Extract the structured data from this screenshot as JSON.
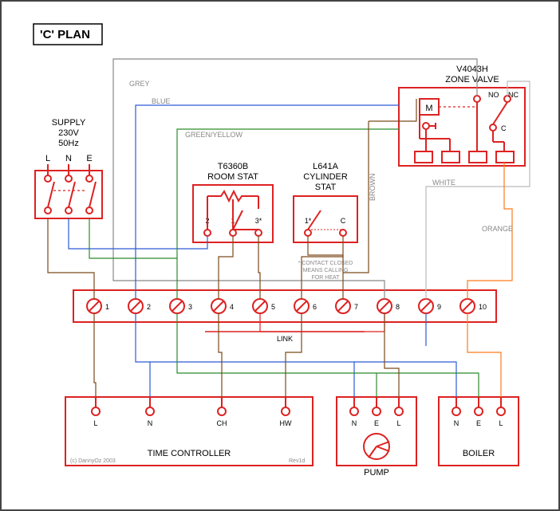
{
  "title": "'C' PLAN",
  "supply": {
    "label": "SUPPLY",
    "voltage": "230V",
    "freq": "50Hz",
    "L": "L",
    "N": "N",
    "E": "E"
  },
  "roomstat": {
    "model": "T6360B",
    "label": "ROOM STAT",
    "t1": "1",
    "t2": "2",
    "t3": "3*"
  },
  "cylstat": {
    "model": "L641A",
    "label1": "CYLINDER",
    "label2": "STAT",
    "t1": "1*",
    "t2": "C",
    "note1": "* CONTACT CLOSED",
    "note2": "MEANS CALLING",
    "note3": "FOR HEAT"
  },
  "zonevalve": {
    "model": "V4043H",
    "label": "ZONE VALVE",
    "M": "M",
    "NO": "NO",
    "NC": "NC",
    "C": "C"
  },
  "junction": {
    "link": "LINK",
    "t": [
      "1",
      "2",
      "3",
      "4",
      "5",
      "6",
      "7",
      "8",
      "9",
      "10"
    ]
  },
  "timecontroller": {
    "label": "TIME CONTROLLER",
    "L": "L",
    "N": "N",
    "CH": "CH",
    "HW": "HW",
    "rev": "Rev1d",
    "copy": "(c) DannyOz 2003"
  },
  "pump": {
    "label": "PUMP",
    "N": "N",
    "E": "E",
    "L": "L"
  },
  "boiler": {
    "label": "BOILER",
    "N": "N",
    "E": "E",
    "L": "L"
  },
  "wires": {
    "grey": "GREY",
    "blue": "BLUE",
    "green": "GREEN/YELLOW",
    "brown": "BROWN",
    "white": "WHITE",
    "orange": "ORANGE"
  },
  "colors": {
    "red": "#d22",
    "blue": "#2d5bd6",
    "green": "#2b8b2b",
    "grey": "#888",
    "black": "#000",
    "brown": "#7a4a1a",
    "orange": "#ff7a1a",
    "white": "#bbb"
  }
}
